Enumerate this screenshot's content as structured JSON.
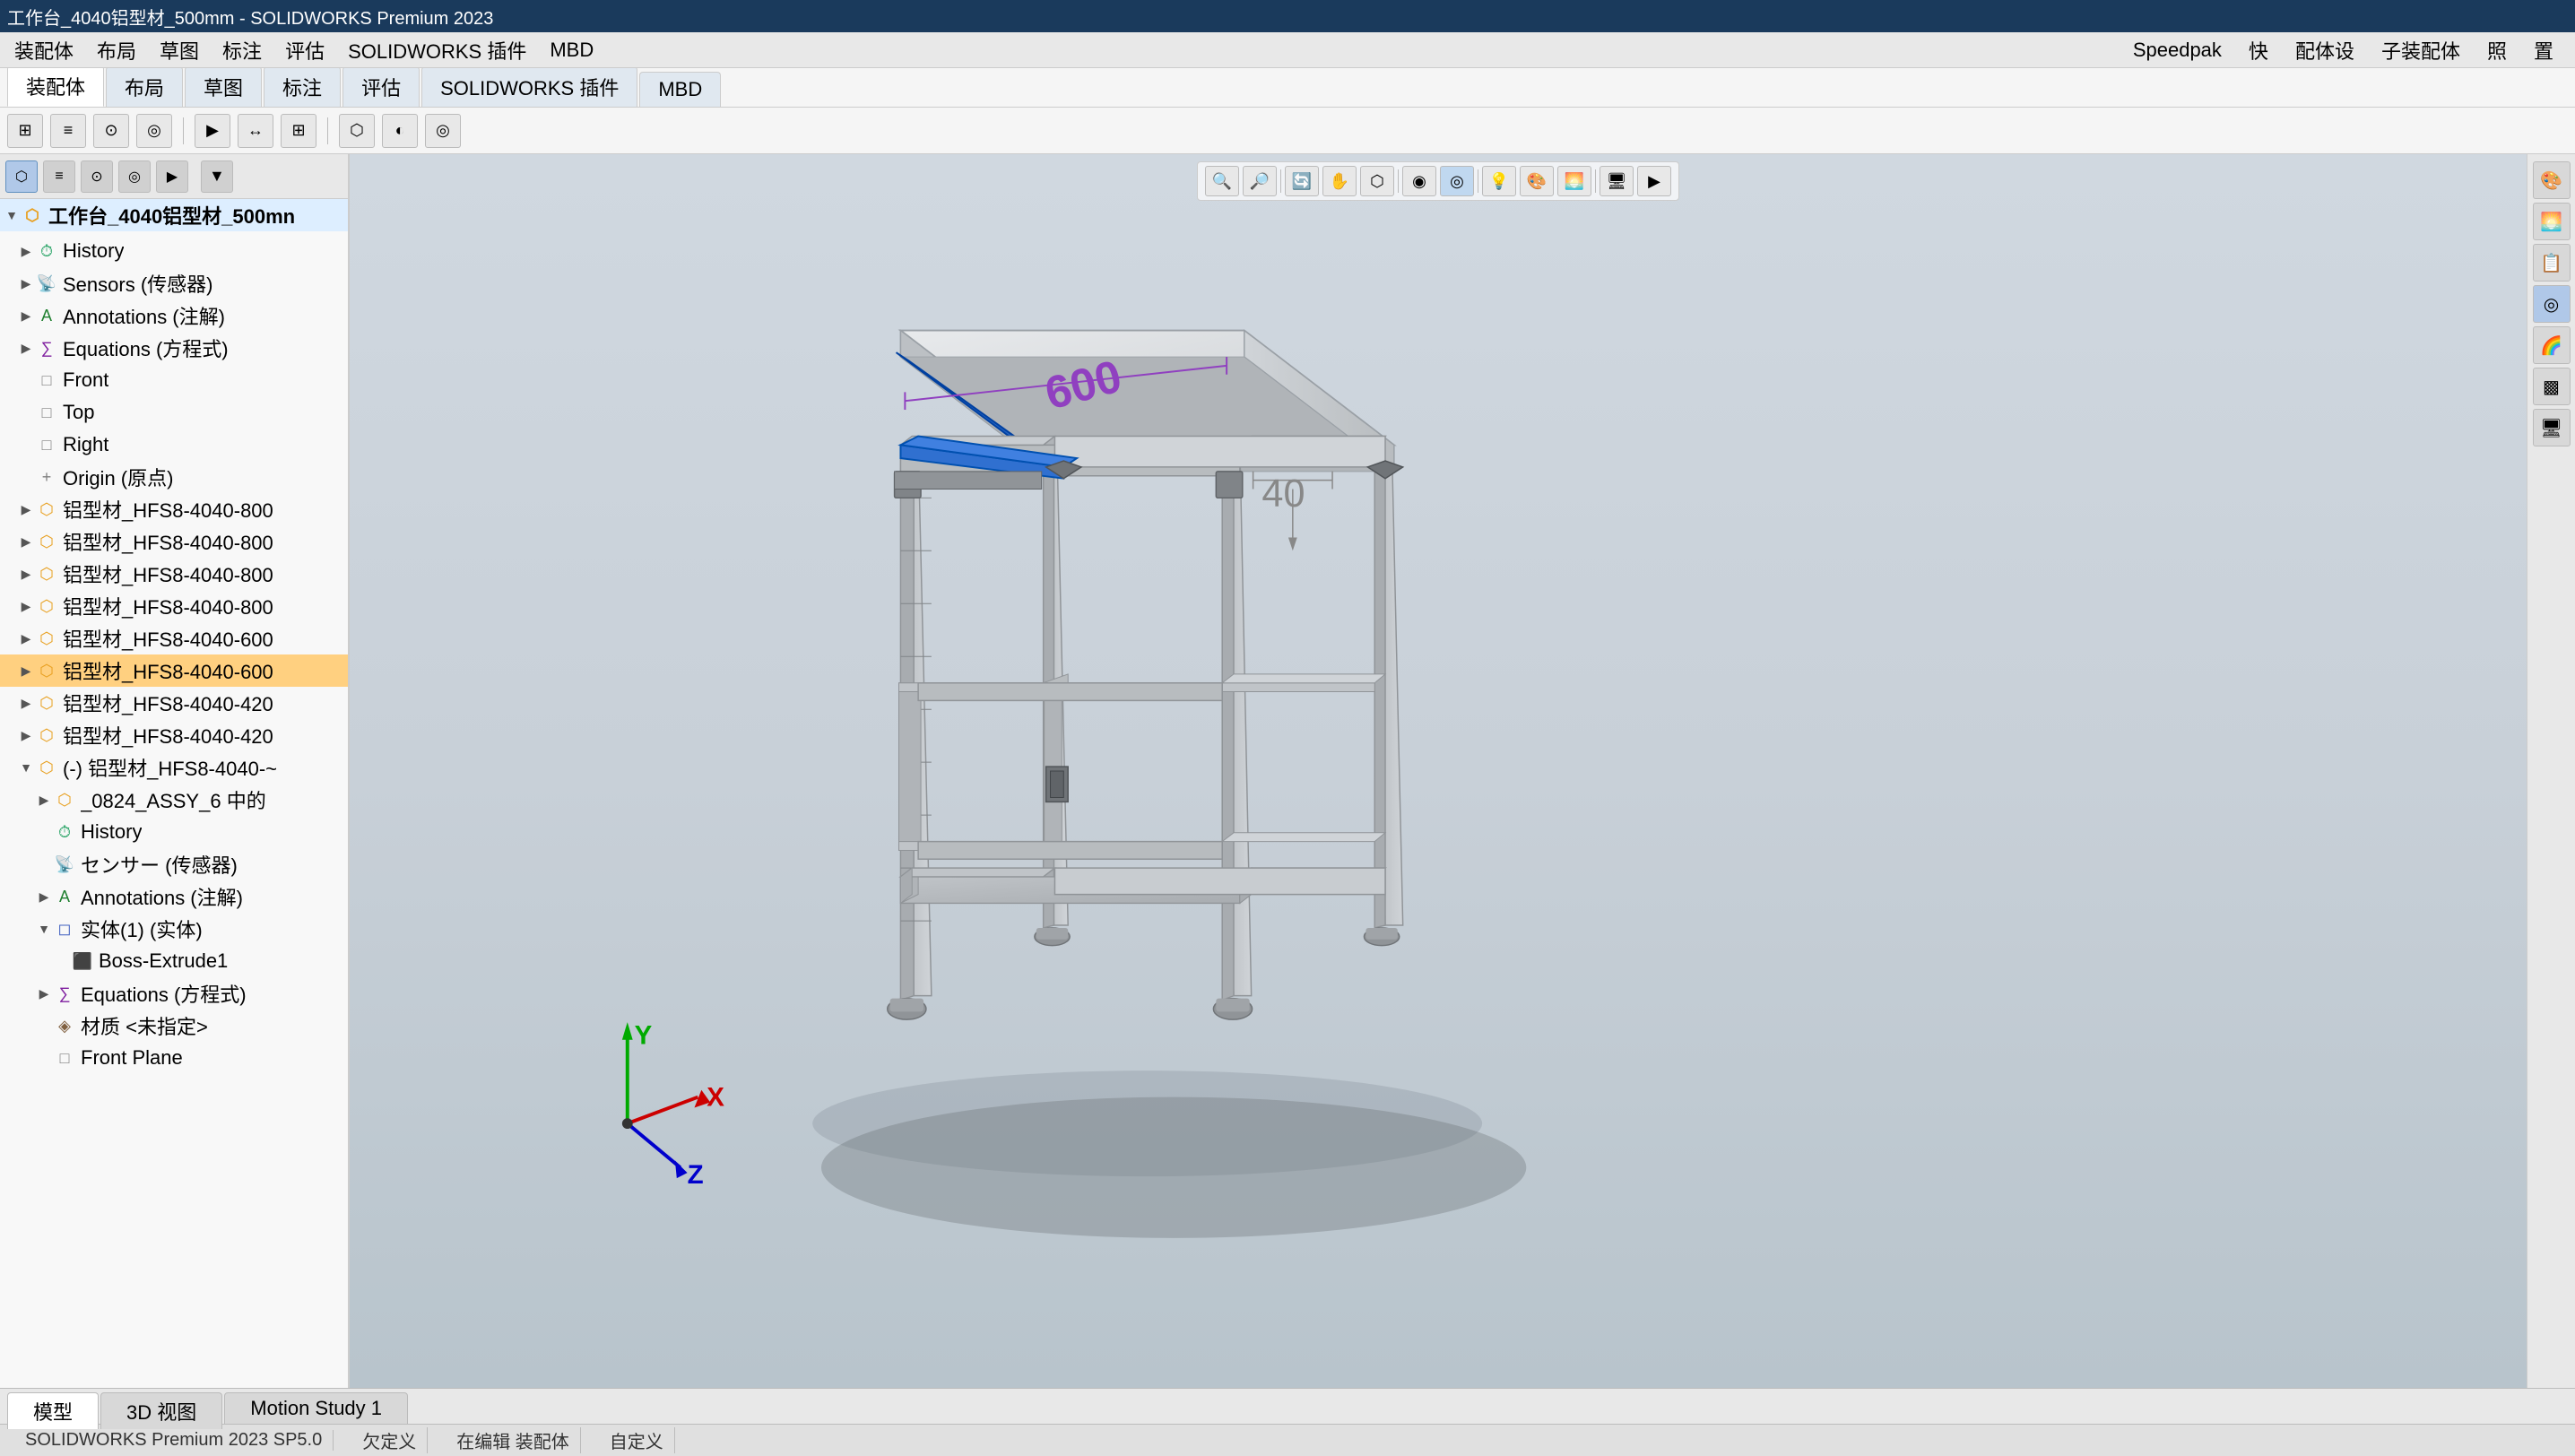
{
  "app": {
    "title": "工作台_4040铝型材_500mm - SOLIDWORKS Premium 2023",
    "status_bar": "SOLIDWORKS Premium 2023 SP5.0"
  },
  "menu": {
    "items": [
      "装配体",
      "布局",
      "草图",
      "标注",
      "评估",
      "SOLIDWORKS 插件",
      "MBD"
    ]
  },
  "speedpak": {
    "label": "Speedpak",
    "items": [
      "快",
      "配体设",
      "子装配体",
      "照",
      "置"
    ]
  },
  "toolbar": {
    "buttons": [
      "⊕",
      "↔",
      "⊞",
      "◎",
      "⬡",
      "▶"
    ]
  },
  "left_panel": {
    "tabs": [
      "⊞",
      "≡",
      "⊙",
      "◎",
      "▶"
    ],
    "root_item": "工作台_4040铝型材_500mn",
    "tree": [
      {
        "level": 1,
        "label": "History",
        "icon": "H",
        "icon_type": "history",
        "expandable": true,
        "expanded": false
      },
      {
        "level": 1,
        "label": "Sensors (传感器)",
        "icon": "S",
        "icon_type": "sensor",
        "expandable": true,
        "expanded": false
      },
      {
        "level": 1,
        "label": "Annotations (注解)",
        "icon": "A",
        "icon_type": "annotation",
        "expandable": true,
        "expanded": false
      },
      {
        "level": 1,
        "label": "Equations (方程式)",
        "icon": "E",
        "icon_type": "equation",
        "expandable": true,
        "expanded": false
      },
      {
        "level": 1,
        "label": "Front",
        "icon": "□",
        "icon_type": "plane",
        "expandable": false
      },
      {
        "level": 1,
        "label": "Top",
        "icon": "□",
        "icon_type": "plane",
        "expandable": false
      },
      {
        "level": 1,
        "label": "Right",
        "icon": "□",
        "icon_type": "plane",
        "expandable": false
      },
      {
        "level": 1,
        "label": "Origin (原点)",
        "icon": "+",
        "icon_type": "origin",
        "expandable": false
      },
      {
        "level": 1,
        "label": "铝型材_HFS8-4040-800",
        "icon": "P",
        "icon_type": "part",
        "expandable": true,
        "expanded": false
      },
      {
        "level": 1,
        "label": "铝型材_HFS8-4040-800",
        "icon": "P",
        "icon_type": "part",
        "expandable": true,
        "expanded": false
      },
      {
        "level": 1,
        "label": "铝型材_HFS8-4040-800",
        "icon": "P",
        "icon_type": "part",
        "expandable": true,
        "expanded": false
      },
      {
        "level": 1,
        "label": "铝型材_HFS8-4040-800",
        "icon": "P",
        "icon_type": "part",
        "expandable": true,
        "expanded": false
      },
      {
        "level": 1,
        "label": "铝型材_HFS8-4040-600",
        "icon": "P",
        "icon_type": "part",
        "expandable": true,
        "expanded": false
      },
      {
        "level": 1,
        "label": "铝型材_HFS8-4040-600",
        "icon": "P",
        "icon_type": "part",
        "expandable": true,
        "expanded": false,
        "selected": true
      },
      {
        "level": 1,
        "label": "铝型材_HFS8-4040-420",
        "icon": "P",
        "icon_type": "part",
        "expandable": true,
        "expanded": false
      },
      {
        "level": 1,
        "label": "铝型材_HFS8-4040-420",
        "icon": "P",
        "icon_type": "part",
        "expandable": true,
        "expanded": false
      },
      {
        "level": 1,
        "label": "(-) 铝型材_HFS8-4040-~",
        "icon": "P",
        "icon_type": "part",
        "expandable": true,
        "expanded": true
      },
      {
        "level": 2,
        "label": "_0824_ASSY_6 中的",
        "icon": "A",
        "icon_type": "assembly",
        "expandable": true,
        "expanded": false
      },
      {
        "level": 2,
        "label": "History",
        "icon": "H",
        "icon_type": "history",
        "expandable": false
      },
      {
        "level": 2,
        "label": "センサー (传感器)",
        "icon": "S",
        "icon_type": "sensor",
        "expandable": false
      },
      {
        "level": 2,
        "label": "Annotations (注解)",
        "icon": "A",
        "icon_type": "annotation",
        "expandable": true,
        "expanded": false
      },
      {
        "level": 2,
        "label": "实体(1) (实体)",
        "icon": "B",
        "icon_type": "body",
        "expandable": true,
        "expanded": true
      },
      {
        "level": 3,
        "label": "Boss-Extrude1",
        "icon": "F",
        "icon_type": "boss",
        "expandable": false
      },
      {
        "level": 2,
        "label": "Equations (方程式)",
        "icon": "E",
        "icon_type": "equation",
        "expandable": true,
        "expanded": false
      },
      {
        "level": 2,
        "label": "材质 <未指定>",
        "icon": "M",
        "icon_type": "material",
        "expandable": false
      },
      {
        "level": 2,
        "label": "Front Plane",
        "icon": "□",
        "icon_type": "plane",
        "expandable": false
      }
    ]
  },
  "viewport": {
    "toolbar": {
      "buttons": [
        "🔍",
        "🔎",
        "👁",
        "🔄",
        "📐",
        "⬡",
        "◉",
        "💡",
        "🎨",
        "🖥"
      ]
    }
  },
  "bottom_tabs": {
    "tabs": [
      "模型",
      "3D 视图",
      "Motion Study 1"
    ],
    "active": "模型"
  },
  "status": {
    "items": [
      "欠定义",
      "在编辑 装配体",
      "自定义"
    ]
  },
  "dimensions": {
    "dim_600": "600",
    "dim_40": "40"
  }
}
